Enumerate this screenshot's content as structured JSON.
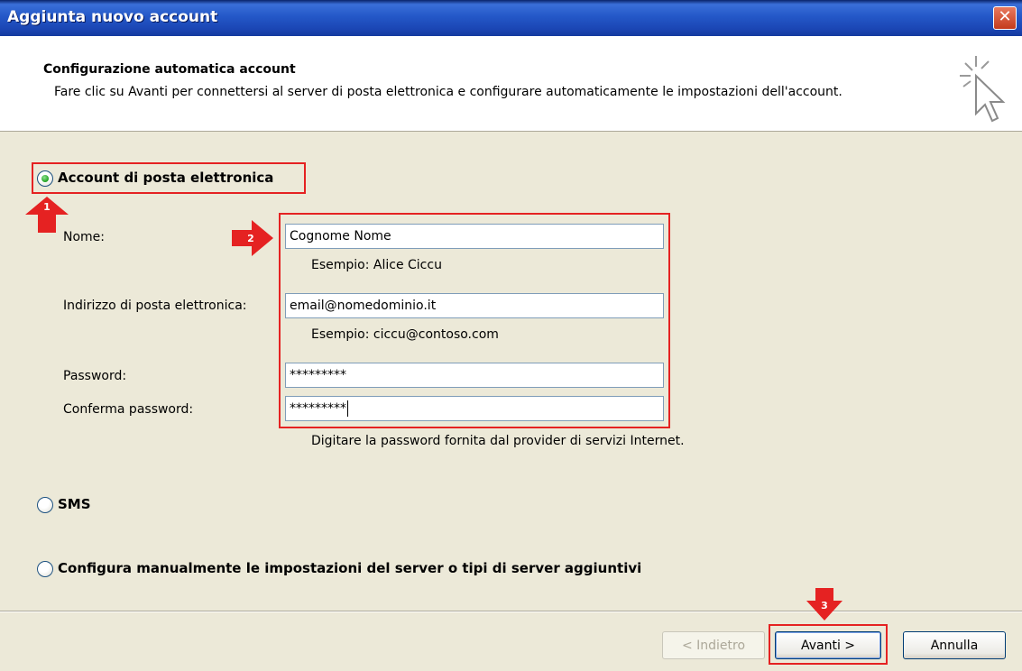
{
  "window": {
    "title": "Aggiunta nuovo account",
    "close_label": "✕"
  },
  "header": {
    "title": "Configurazione automatica account",
    "description": "Fare clic su Avanti per connettersi al server di posta elettronica e configurare automaticamente le impostazioni dell'account.",
    "icon": "cursor-sparkle-icon"
  },
  "options": {
    "email_account": {
      "label": "Account di posta elettronica",
      "selected": true
    },
    "sms": {
      "label": "SMS",
      "selected": false
    },
    "manual": {
      "label": "Configura manualmente le impostazioni del server o tipi di server aggiuntivi",
      "selected": false
    }
  },
  "form": {
    "name_label": "Nome:",
    "name_value": "Cognome Nome",
    "name_hint": "Esempio: Alice Ciccu",
    "email_label": "Indirizzo di posta elettronica:",
    "email_value": "email@nomedominio.it",
    "email_hint": "Esempio: ciccu@contoso.com",
    "password_label": "Password:",
    "password_value": "*********",
    "confirm_label": "Conferma password:",
    "confirm_value": "*********",
    "password_hint": "Digitare la password fornita dal provider di servizi Internet."
  },
  "annotations": {
    "step1": "1",
    "step2": "2",
    "step3": "3",
    "color": "#e52222"
  },
  "buttons": {
    "back": "< Indietro",
    "next": "Avanti >",
    "cancel": "Annulla"
  }
}
